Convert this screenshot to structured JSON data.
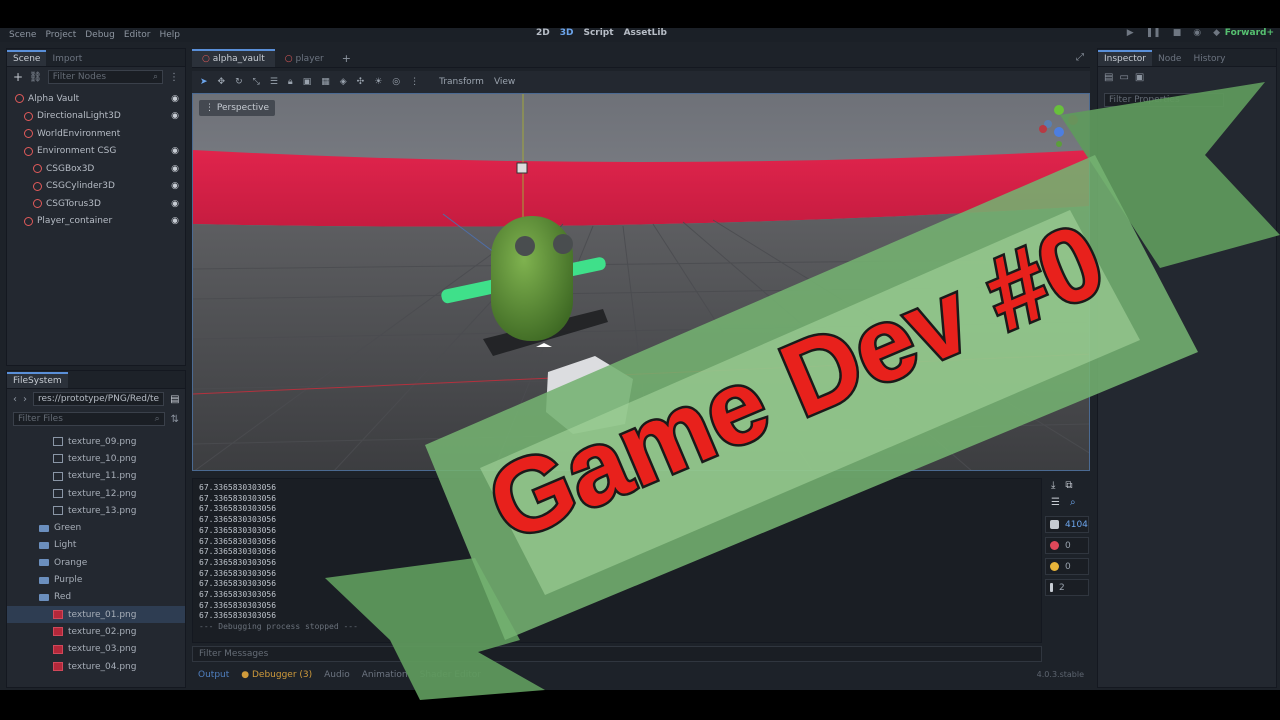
{
  "menus": [
    "Scene",
    "Project",
    "Debug",
    "Editor",
    "Help"
  ],
  "modes": [
    {
      "label": "2D",
      "active": false
    },
    {
      "label": "3D",
      "active": true
    },
    {
      "label": "Script",
      "active": false
    },
    {
      "label": "AssetLib",
      "active": false
    }
  ],
  "renderer": "Forward+",
  "scene_dock": {
    "tabs": [
      "Scene",
      "Import"
    ],
    "filter_placeholder": "Filter Nodes",
    "tree": [
      {
        "label": "Alpha Vault",
        "indent": 0,
        "icon_color": "#e05a5a",
        "eye": true
      },
      {
        "label": "DirectionalLight3D",
        "indent": 1,
        "icon_color": "#e05a5a",
        "eye": true
      },
      {
        "label": "WorldEnvironment",
        "indent": 1,
        "icon_color": "#e05a5a",
        "eye": false
      },
      {
        "label": "Environment CSG",
        "indent": 1,
        "icon_color": "#e05a5a",
        "eye": true
      },
      {
        "label": "CSGBox3D",
        "indent": 2,
        "icon_color": "#e05a5a",
        "eye": true
      },
      {
        "label": "CSGCylinder3D",
        "indent": 2,
        "icon_color": "#e05a5a",
        "eye": true
      },
      {
        "label": "CSGTorus3D",
        "indent": 2,
        "icon_color": "#e05a5a",
        "eye": true
      },
      {
        "label": "Player_container",
        "indent": 1,
        "icon_color": "#e05a5a",
        "eye": true
      }
    ]
  },
  "filesystem": {
    "title": "FileSystem",
    "path": "res://prototype/PNG/Red/te",
    "filter_placeholder": "Filter Files",
    "items": [
      {
        "label": "texture_09.png",
        "type": "file",
        "indent": 2,
        "red": false
      },
      {
        "label": "texture_10.png",
        "type": "file",
        "indent": 2,
        "red": false
      },
      {
        "label": "texture_11.png",
        "type": "file",
        "indent": 2,
        "red": false
      },
      {
        "label": "texture_12.png",
        "type": "file",
        "indent": 2,
        "red": false
      },
      {
        "label": "texture_13.png",
        "type": "file",
        "indent": 2,
        "red": false
      },
      {
        "label": "Green",
        "type": "folder",
        "indent": 1
      },
      {
        "label": "Light",
        "type": "folder",
        "indent": 1
      },
      {
        "label": "Orange",
        "type": "folder",
        "indent": 1
      },
      {
        "label": "Purple",
        "type": "folder",
        "indent": 1
      },
      {
        "label": "Red",
        "type": "folder",
        "indent": 1
      },
      {
        "label": "texture_01.png",
        "type": "file",
        "indent": 2,
        "red": true,
        "selected": true
      },
      {
        "label": "texture_02.png",
        "type": "file",
        "indent": 2,
        "red": true
      },
      {
        "label": "texture_03.png",
        "type": "file",
        "indent": 2,
        "red": true
      },
      {
        "label": "texture_04.png",
        "type": "file",
        "indent": 2,
        "red": true
      }
    ]
  },
  "editor_tabs": [
    "alpha_vault",
    "player"
  ],
  "viewport": {
    "menu_transform": "Transform",
    "menu_view": "View",
    "perspective_label": "Perspective"
  },
  "console": {
    "lines": [
      "67.3365830303056",
      "67.3365830303056",
      "67.3365830303056",
      "67.3365830303056",
      "67.3365830303056",
      "67.3365830303056",
      "67.3365830303056",
      "67.3365830303056",
      "67.3365830303056",
      "67.3365830303056",
      "67.3365830303056",
      "67.3365830303056",
      "67.3365830303056"
    ],
    "stop_line": "--- Debugging process stopped ---",
    "filter_placeholder": "Filter Messages"
  },
  "counters": {
    "messages": "4104",
    "errors": "0",
    "warnings": "0",
    "info": "2"
  },
  "bottom_tabs": [
    "Output",
    "Debugger (3)",
    "Audio",
    "Animation",
    "Shader Editor"
  ],
  "version": "4.0.3.stable",
  "inspector": {
    "tabs": [
      "Inspector",
      "Node",
      "History"
    ],
    "filter_placeholder": "Filter Properties"
  },
  "banner": {
    "text": "Game Dev #0"
  },
  "colors": {
    "accent": "#5a8fd8",
    "wall": "#d8234a",
    "banner_green": "#6aa86a",
    "banner_text": "#e8211c"
  }
}
